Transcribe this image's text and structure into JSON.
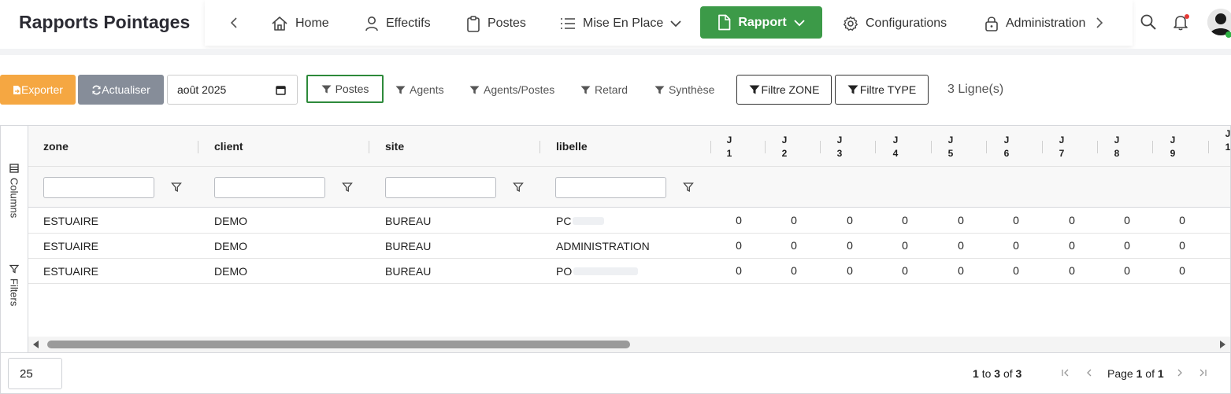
{
  "app": {
    "title": "Rapports Pointages"
  },
  "nav": {
    "items": [
      {
        "label": "Home",
        "icon": "home-icon"
      },
      {
        "label": "Effectifs",
        "icon": "person-icon"
      },
      {
        "label": "Postes",
        "icon": "clipboard-icon"
      },
      {
        "label": "Mise En Place",
        "icon": "list-icon"
      },
      {
        "label": "Rapport",
        "icon": "document-icon",
        "active": true
      },
      {
        "label": "Configurations",
        "icon": "gear-icon"
      },
      {
        "label": "Administration",
        "icon": "lock-icon"
      }
    ],
    "active_color": "#3c9a48"
  },
  "toolbar": {
    "export_label": "Exporter",
    "refresh_label": "Actualiser",
    "date_value": "août 2025",
    "tabs": [
      {
        "label": "Postes",
        "active": true
      },
      {
        "label": "Agents"
      },
      {
        "label": "Agents/Postes"
      },
      {
        "label": "Retard"
      },
      {
        "label": "Synthèse"
      }
    ],
    "filter_zone_label": "Filtre ZONE",
    "filter_type_label": "Filtre TYPE",
    "row_count": "3 Ligne(s)",
    "export_color": "#f5a742",
    "refresh_color": "#868d99"
  },
  "grid": {
    "sidebar": {
      "columns_label": "Columns",
      "filters_label": "Filters"
    },
    "columns": [
      "zone",
      "client",
      "site",
      "libelle"
    ],
    "day_columns": [
      {
        "j": "J",
        "n": "1"
      },
      {
        "j": "J",
        "n": "2"
      },
      {
        "j": "J",
        "n": "3"
      },
      {
        "j": "J",
        "n": "4"
      },
      {
        "j": "J",
        "n": "5"
      },
      {
        "j": "J",
        "n": "6"
      },
      {
        "j": "J",
        "n": "7"
      },
      {
        "j": "J",
        "n": "8"
      },
      {
        "j": "J",
        "n": "9"
      },
      {
        "j": "J",
        "n": "1"
      }
    ],
    "rows": [
      {
        "zone": "ESTUAIRE",
        "client": "DEMO",
        "site": "BUREAU",
        "libelle": "PC",
        "days": [
          "0",
          "0",
          "0",
          "0",
          "0",
          "0",
          "0",
          "0",
          "0"
        ]
      },
      {
        "zone": "ESTUAIRE",
        "client": "DEMO",
        "site": "BUREAU",
        "libelle": "ADMINISTRATION",
        "days": [
          "0",
          "0",
          "0",
          "0",
          "0",
          "0",
          "0",
          "0",
          "0"
        ]
      },
      {
        "zone": "ESTUAIRE",
        "client": "DEMO",
        "site": "BUREAU",
        "libelle": "PO",
        "days": [
          "0",
          "0",
          "0",
          "0",
          "0",
          "0",
          "0",
          "0",
          "0"
        ]
      }
    ]
  },
  "pagination": {
    "page_size": "25",
    "range_start": "1",
    "to_word": "to",
    "range_end": "3",
    "of_word": "of",
    "total": "3",
    "page_word": "Page",
    "current_page": "1",
    "page_of_word": "of",
    "total_pages": "1"
  }
}
